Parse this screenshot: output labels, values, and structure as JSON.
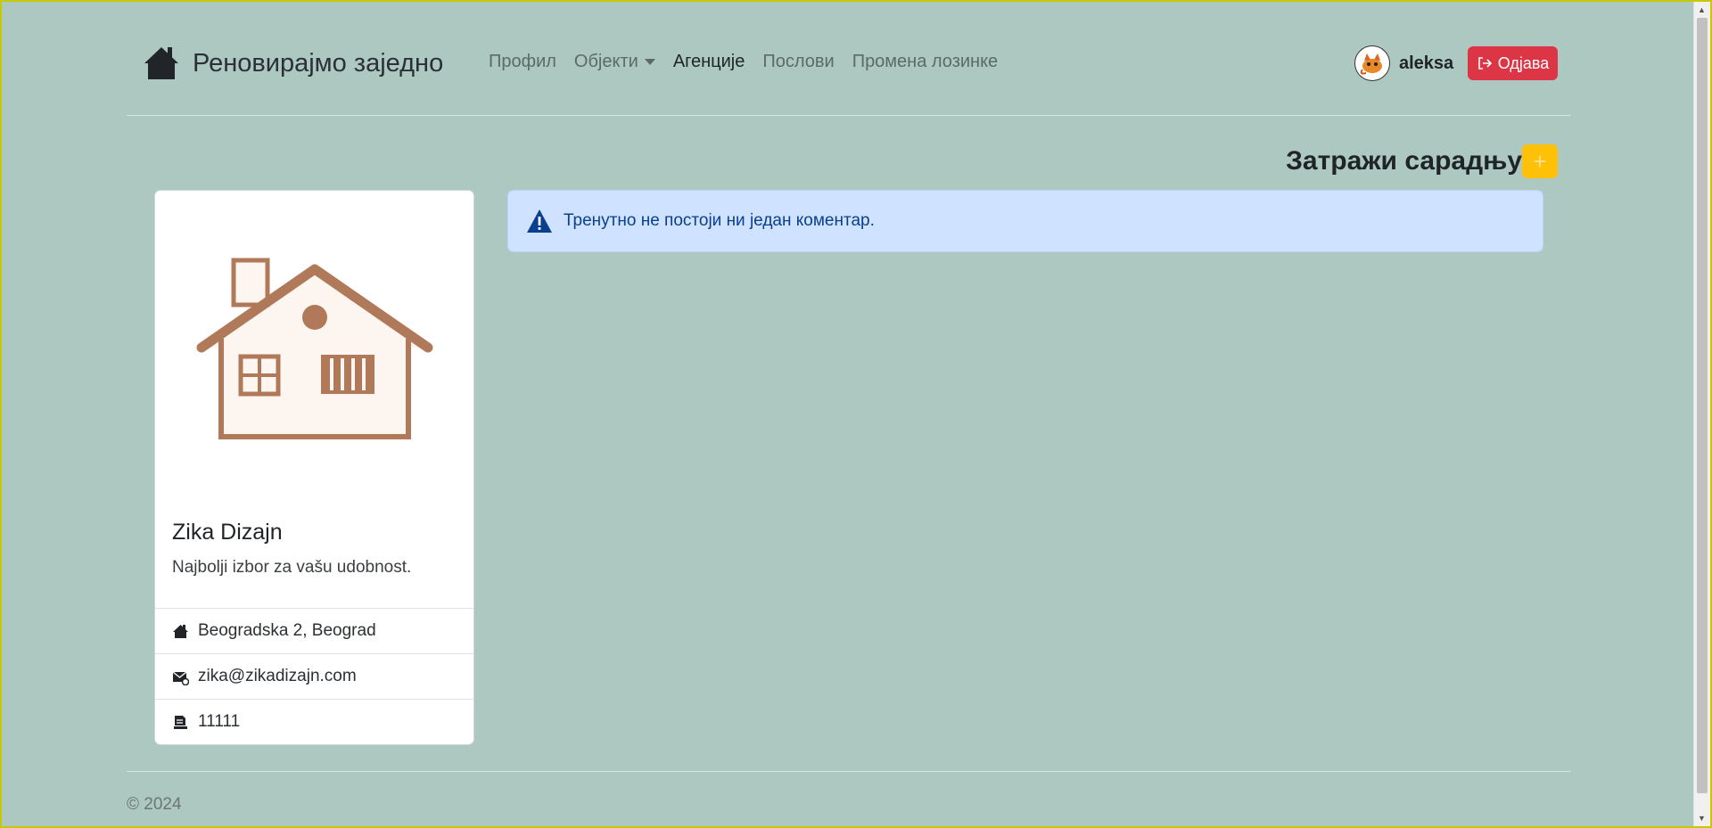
{
  "header": {
    "brand": "Реновирајмо заједно",
    "nav": [
      {
        "label": "Профил",
        "active": false
      },
      {
        "label": "Објекти",
        "active": false,
        "dropdown": true
      },
      {
        "label": "Агенције",
        "active": true
      },
      {
        "label": "Послови",
        "active": false
      },
      {
        "label": "Промена лозинке",
        "active": false
      }
    ],
    "username": "aleksa",
    "logout_label": "Одјава"
  },
  "collab": {
    "title": "Затражи сарадњу",
    "button_label": "+"
  },
  "agency": {
    "name": "Zika Dizajn",
    "description": "Najbolji izbor za vašu udobnost.",
    "address": "Beogradska 2, Beograd",
    "email": "zika@zikadizajn.com",
    "phone": "11111"
  },
  "alert": {
    "text": "Тренутно не постоји ни један коментар."
  },
  "footer": {
    "text": "© 2024"
  },
  "colors": {
    "background": "#adc8c0",
    "danger": "#dc3545",
    "warning": "#ffc107",
    "info_bg": "#cfe2ff",
    "house_brown": "#b07a5a"
  }
}
